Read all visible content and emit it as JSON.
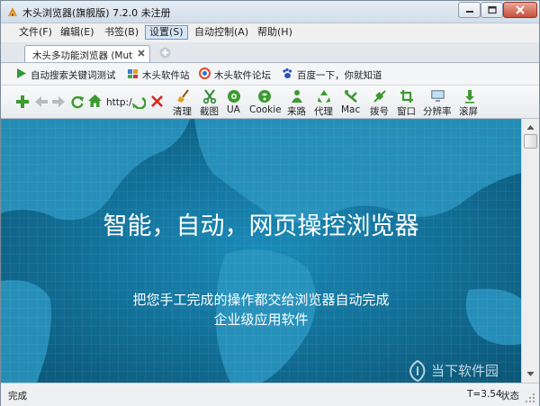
{
  "window": {
    "title": "木头浏览器(旗舰版) 7.2.0  未注册",
    "icons": {
      "app": "wood-browser-logo-icon",
      "minimize": "minimize-icon",
      "maximize": "maximize-icon",
      "close": "close-icon"
    }
  },
  "menu": [
    {
      "label": "文件(F)"
    },
    {
      "label": "编辑(E)"
    },
    {
      "label": "书签(B)"
    },
    {
      "label": "设置(S)",
      "active": true
    },
    {
      "label": "自动控制(A)"
    },
    {
      "label": "帮助(H)"
    }
  ],
  "tabs": [
    {
      "label": "木头多功能浏览器 (Mutou"
    }
  ],
  "bookmarks": [
    {
      "label": "自动搜索关键词测试",
      "icon": "play-icon"
    },
    {
      "label": "木头软件站",
      "icon": "wood-logo-icon"
    },
    {
      "label": "木头软件论坛",
      "icon": "forum-ring-icon"
    },
    {
      "label": "百度一下，你就知道",
      "icon": "baidu-paw-icon"
    }
  ],
  "toolbar": {
    "address_prefix": "http:/",
    "nav_icons": [
      "add-icon",
      "back-icon",
      "forward-icon",
      "refresh-icon",
      "home-icon",
      "go-icon",
      "stop-icon"
    ],
    "tools": [
      {
        "label": "清理",
        "icon": "broom-icon"
      },
      {
        "label": "截图",
        "icon": "scissors-icon"
      },
      {
        "label": "UA",
        "icon": "android-ua-icon"
      },
      {
        "label": "Cookie",
        "icon": "cookie-icon"
      },
      {
        "label": "来路",
        "icon": "referer-icon"
      },
      {
        "label": "代理",
        "icon": "proxy-recycle-icon"
      },
      {
        "label": "Mac",
        "icon": "mac-tools-icon"
      },
      {
        "label": "拨号",
        "icon": "dial-plug-icon"
      },
      {
        "label": "窗口",
        "icon": "window-crop-icon"
      },
      {
        "label": "分辨率",
        "icon": "monitor-icon"
      },
      {
        "label": "滚屏",
        "icon": "scroll-down-icon"
      }
    ]
  },
  "content": {
    "headline": "智能，自动，网页操控浏览器",
    "subline1": "把您手工完成的操作都交给浏览器自动完成",
    "subline2": "企业级应用软件"
  },
  "watermark": {
    "text": "当下软件园"
  },
  "status": {
    "left": "完成",
    "timer": "T=3.54",
    "state": "状态"
  },
  "colors": {
    "content_bg": "#0f6b92",
    "menu_active": "#d7e6f6",
    "close_button": "#c7503b"
  }
}
